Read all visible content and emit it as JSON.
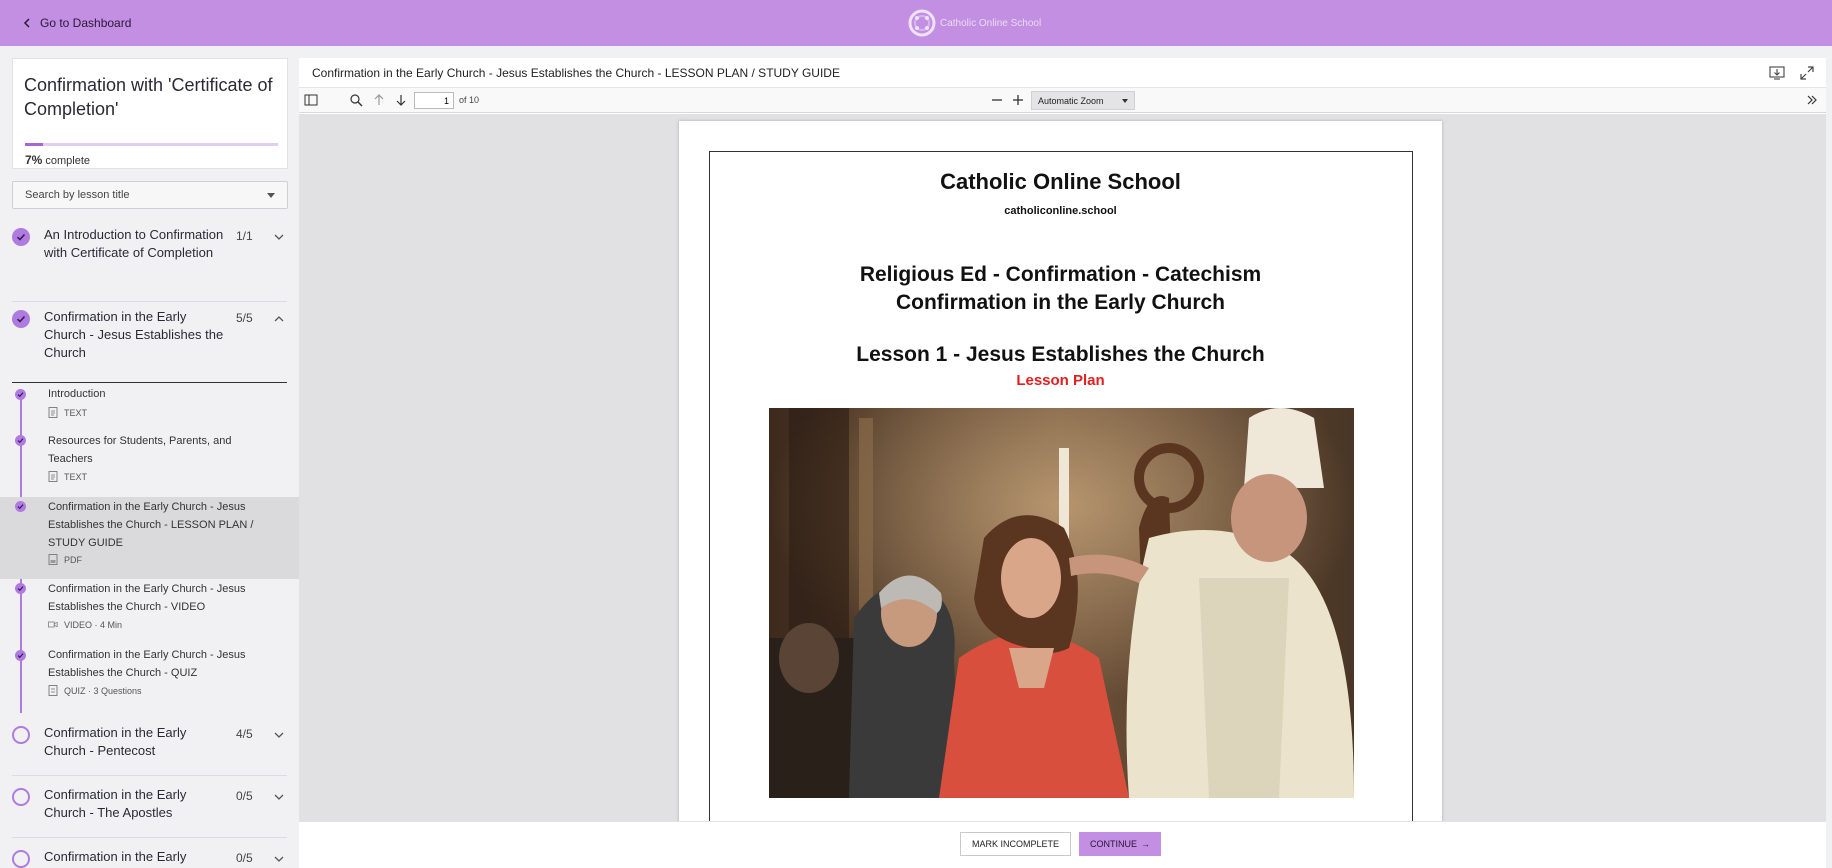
{
  "topbar": {
    "back_label": "Go to Dashboard",
    "logo_text": "Catholic Online School",
    "brand_color": "#c28fe2"
  },
  "course": {
    "title": "Confirmation with 'Certificate of Completion'",
    "progress_percent": 7,
    "progress_value": "7%",
    "progress_suffix": "complete"
  },
  "search": {
    "placeholder": "Search by lesson title"
  },
  "chapters": [
    {
      "title": "An Introduction to Confirmation with Certificate of Completion",
      "count": "1/1",
      "status": "complete"
    },
    {
      "title": "Confirmation in the Early Church - Jesus Establishes the Church",
      "count": "5/5",
      "status": "complete",
      "expanded": true
    },
    {
      "title": "Confirmation in the Early Church - Pentecost",
      "count": "4/5",
      "status": "incomplete"
    },
    {
      "title": "Confirmation in the Early Church - The Apostles",
      "count": "0/5",
      "status": "incomplete"
    },
    {
      "title": "Confirmation in the Early",
      "count": "0/5",
      "status": "incomplete"
    }
  ],
  "lessons": [
    {
      "title": "Introduction",
      "meta": "TEXT",
      "icon": "document-icon"
    },
    {
      "title": "Resources for Students, Parents, and Teachers",
      "meta": "TEXT",
      "icon": "document-icon"
    },
    {
      "title": "Confirmation in the Early Church - Jesus Establishes the Church - LESSON PLAN / STUDY GUIDE",
      "meta": "PDF",
      "icon": "pdf-icon",
      "active": true
    },
    {
      "title": "Confirmation in the Early Church - Jesus Establishes the Church - VIDEO",
      "meta": "VIDEO · 4 Min",
      "icon": "video-icon"
    },
    {
      "title": "Confirmation in the Early Church - Jesus Establishes the Church - QUIZ",
      "meta": "QUIZ · 3 Questions",
      "icon": "quiz-icon"
    }
  ],
  "document": {
    "title": "Confirmation in the Early Church - Jesus Establishes the Church - LESSON PLAN / STUDY GUIDE"
  },
  "pdf_toolbar": {
    "page_value": "1",
    "page_of": "of 10",
    "zoom": "Automatic Zoom"
  },
  "page": {
    "school": "Catholic Online School",
    "url": "catholiconline.school",
    "heading_line1": "Religious Ed - Confirmation - Catechism",
    "heading_line2": "Confirmation in the Early Church",
    "lesson": "Lesson 1 - Jesus Establishes the Church",
    "lesson_plan": "Lesson Plan"
  },
  "footer": {
    "mark_incomplete": "MARK INCOMPLETE",
    "continue": "CONTINUE"
  }
}
